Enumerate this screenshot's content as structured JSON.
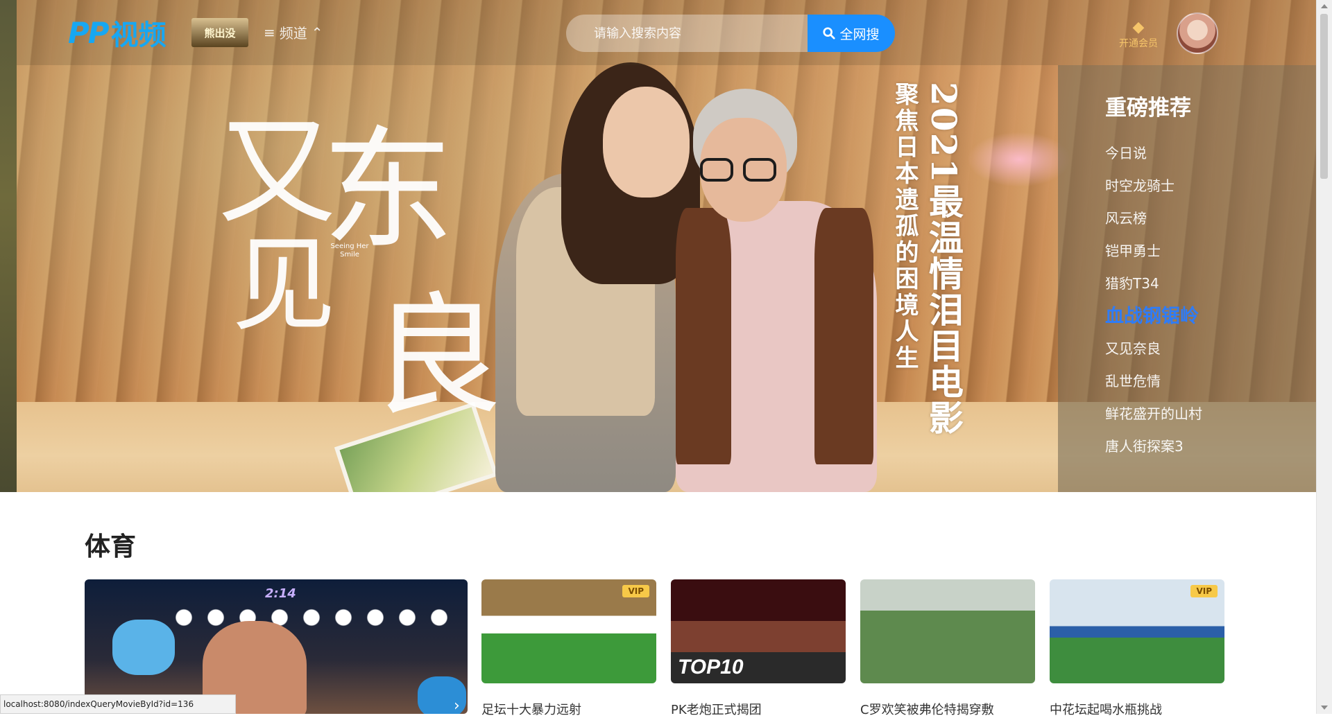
{
  "header": {
    "logo_pp": "PP",
    "logo_text": "视频",
    "mini_logo_text": "熊出没",
    "channel_label": "频道",
    "search_placeholder": "请输入搜索内容",
    "search_button_label": "全网搜",
    "vip_label": "开通会员"
  },
  "hero": {
    "calligraphy": [
      "又",
      "东",
      "见",
      "良"
    ],
    "calligraphy_sub": "Seeing Her Smile",
    "headline": "2021最温情泪目电影",
    "subline": "聚焦日本遗孤的困境人生"
  },
  "recommend": {
    "title": "重磅推荐",
    "items": [
      {
        "label": "今日说"
      },
      {
        "label": "时空龙骑士"
      },
      {
        "label": "风云榜"
      },
      {
        "label": "铠甲勇士"
      },
      {
        "label": "猎豹T34"
      },
      {
        "label": "血战钢锯岭",
        "active": true
      },
      {
        "label": "又见奈良"
      },
      {
        "label": "乱世危情"
      },
      {
        "label": "鲜花盛开的山村"
      },
      {
        "label": "唐人街探案3"
      }
    ]
  },
  "section": {
    "title": "体育",
    "cards": [
      {
        "caption": "",
        "badge": "",
        "score": "2:14"
      },
      {
        "caption": "足坛十大暴力远射",
        "badge": "VIP"
      },
      {
        "caption": "PK老炮正式揭团",
        "badge": "",
        "overlay": "TOP10"
      },
      {
        "caption": "C罗欢笑被弗伦特揭穿敷",
        "badge": ""
      },
      {
        "caption": "中花坛起喝水瓶挑战",
        "badge": "VIP"
      }
    ]
  },
  "status_url": "localhost:8080/indexQueryMovieById?id=136"
}
